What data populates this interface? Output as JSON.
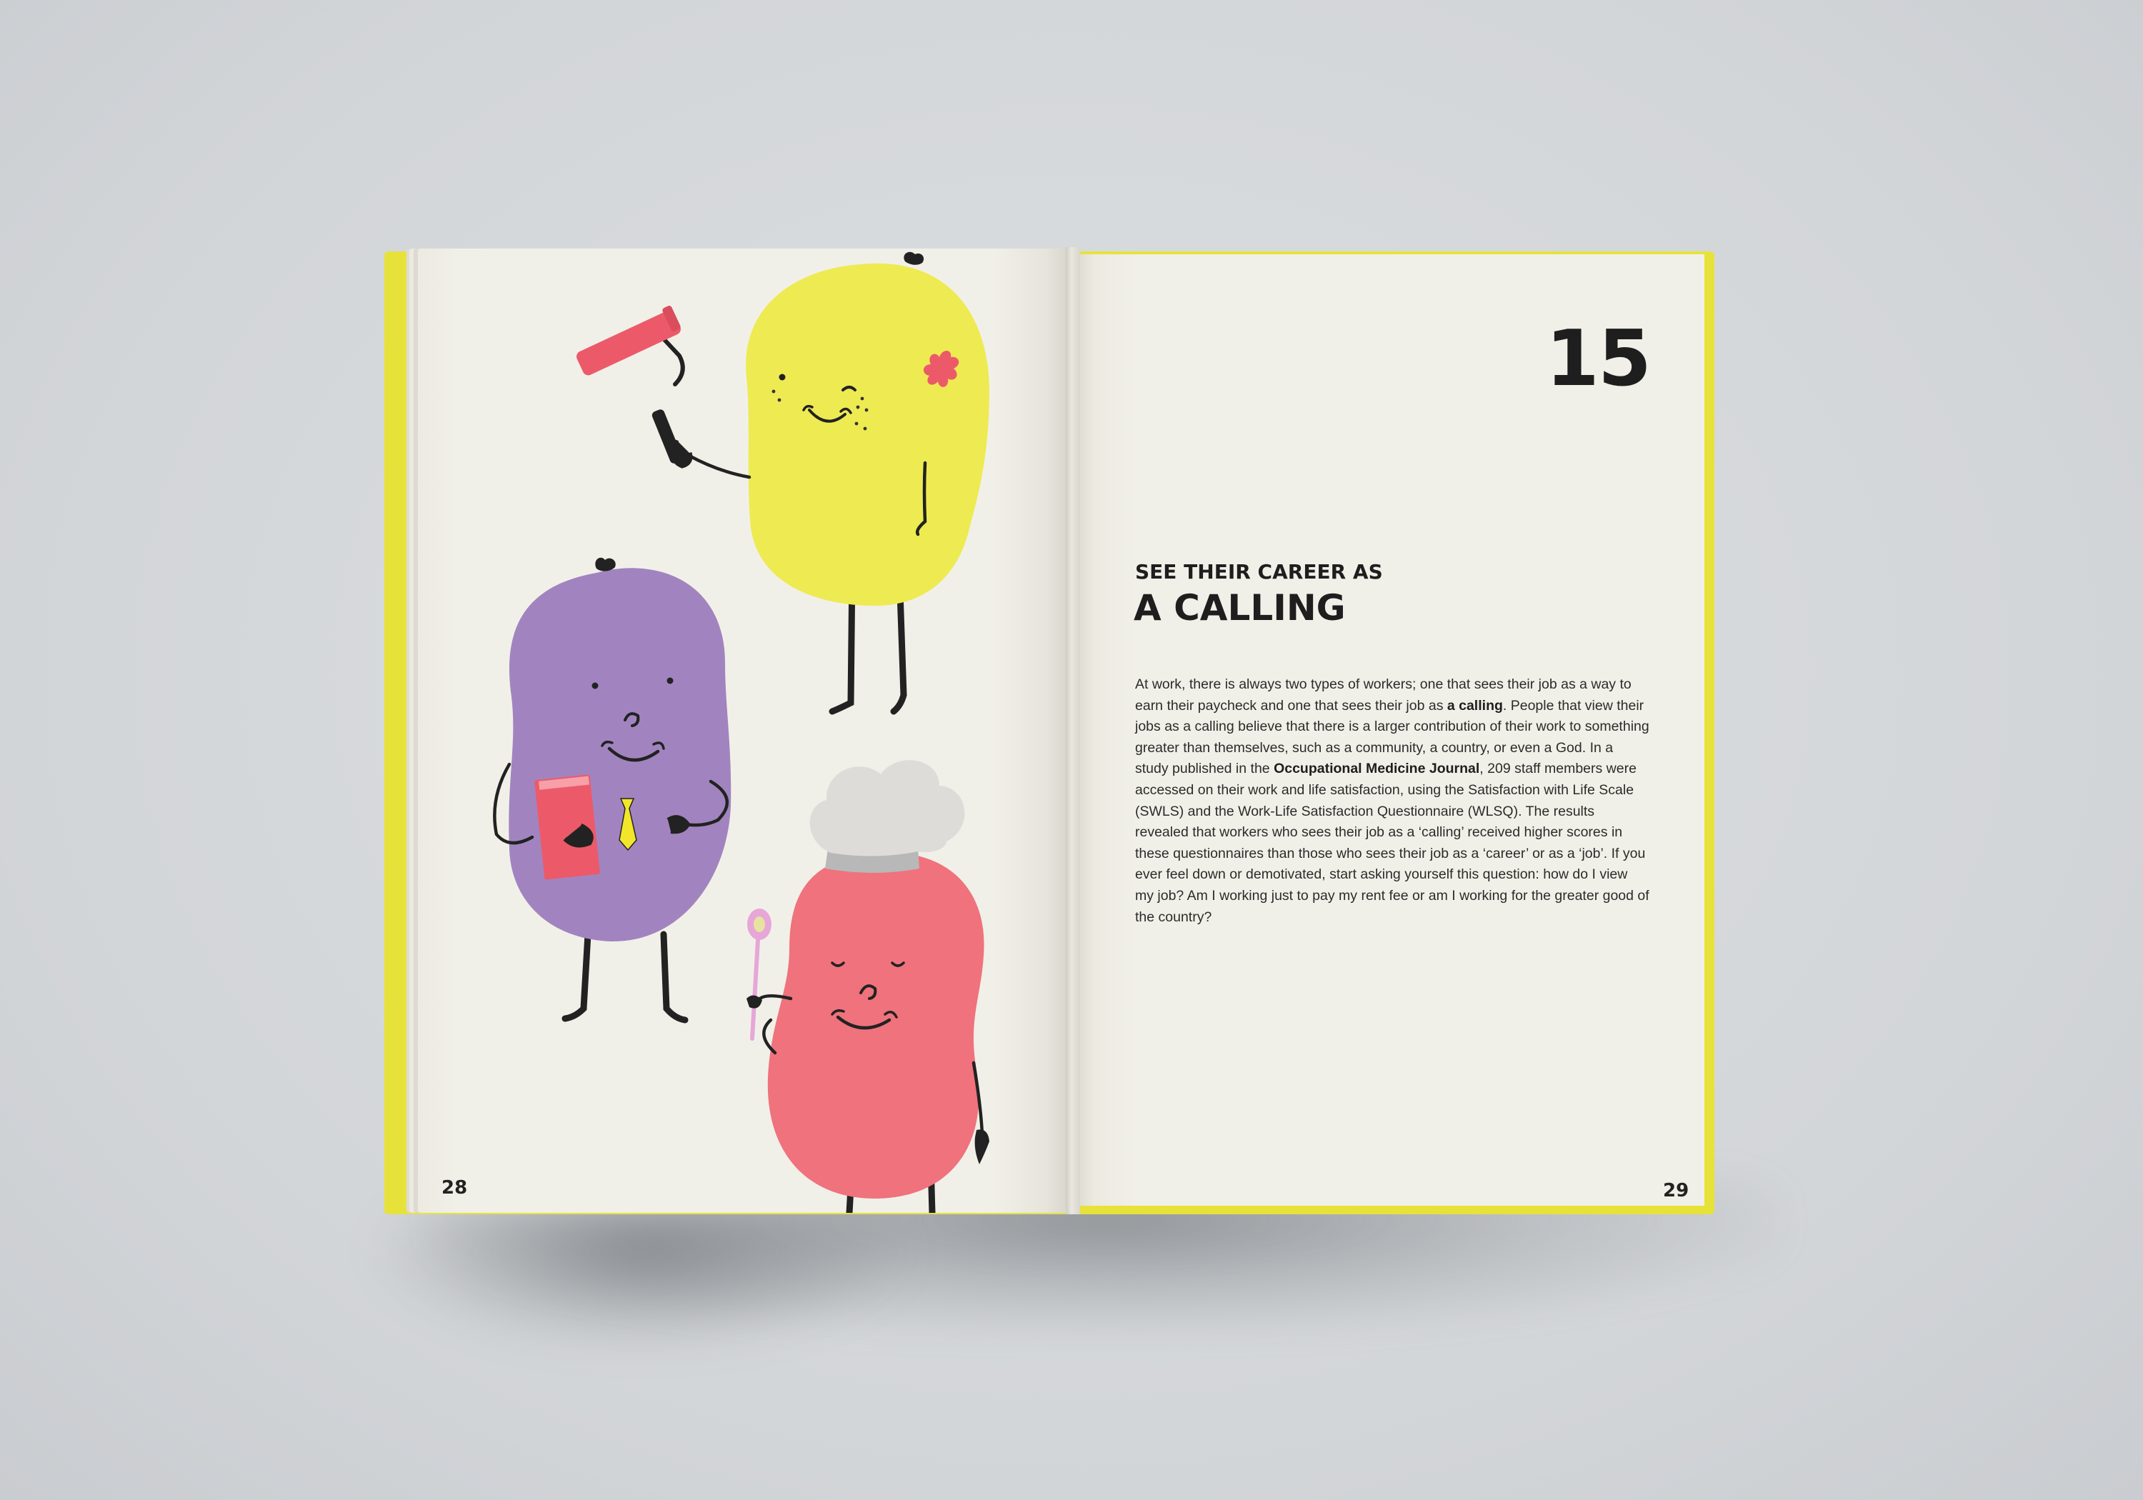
{
  "book": {
    "left_page_number": "28",
    "right_page_number": "29",
    "chapter_number": "15",
    "kicker": "SEE THEIR CAREER AS",
    "headline": "A CALLING",
    "paragraph": [
      {
        "t": "At work, there is always two types of workers; one that sees their job as a way to earn their paycheck and one that sees their job as "
      },
      {
        "t": "a calling",
        "bold": true
      },
      {
        "t": ". People that view their jobs as a calling believe that there is a larger contribution of their work to something greater than themselves, such as a community, a country, or even a God. In a study published in the "
      },
      {
        "t": "Occupational Medicine Journal",
        "bold": true
      },
      {
        "t": ", 209 staff members were accessed on their work and life satisfaction, using the Satisfaction with Life Scale (SWLS) and the Work-Life Satisfaction Questionnaire (WLSQ). The results revealed that workers who sees their job as a ‘calling’ received higher scores in these questionnaires than those who sees their job as a ‘career’ or as a ‘job’. If you ever feel down or demotivated, start asking yourself this question: how do I view my job? Am I working just to pay my rent fee or am I working for the greater good of the country?"
      }
    ]
  },
  "colors": {
    "background": "#d6d9dc",
    "cover": "#e7e23a",
    "page": "#f1f0e8",
    "yellow_character": "#eeea52",
    "purple_character": "#a184bf",
    "red_character": "#ef727c",
    "accent_pink": "#ec5a6a"
  },
  "illustration": {
    "characters": [
      "painter-character",
      "businessman-character",
      "chef-character"
    ]
  }
}
